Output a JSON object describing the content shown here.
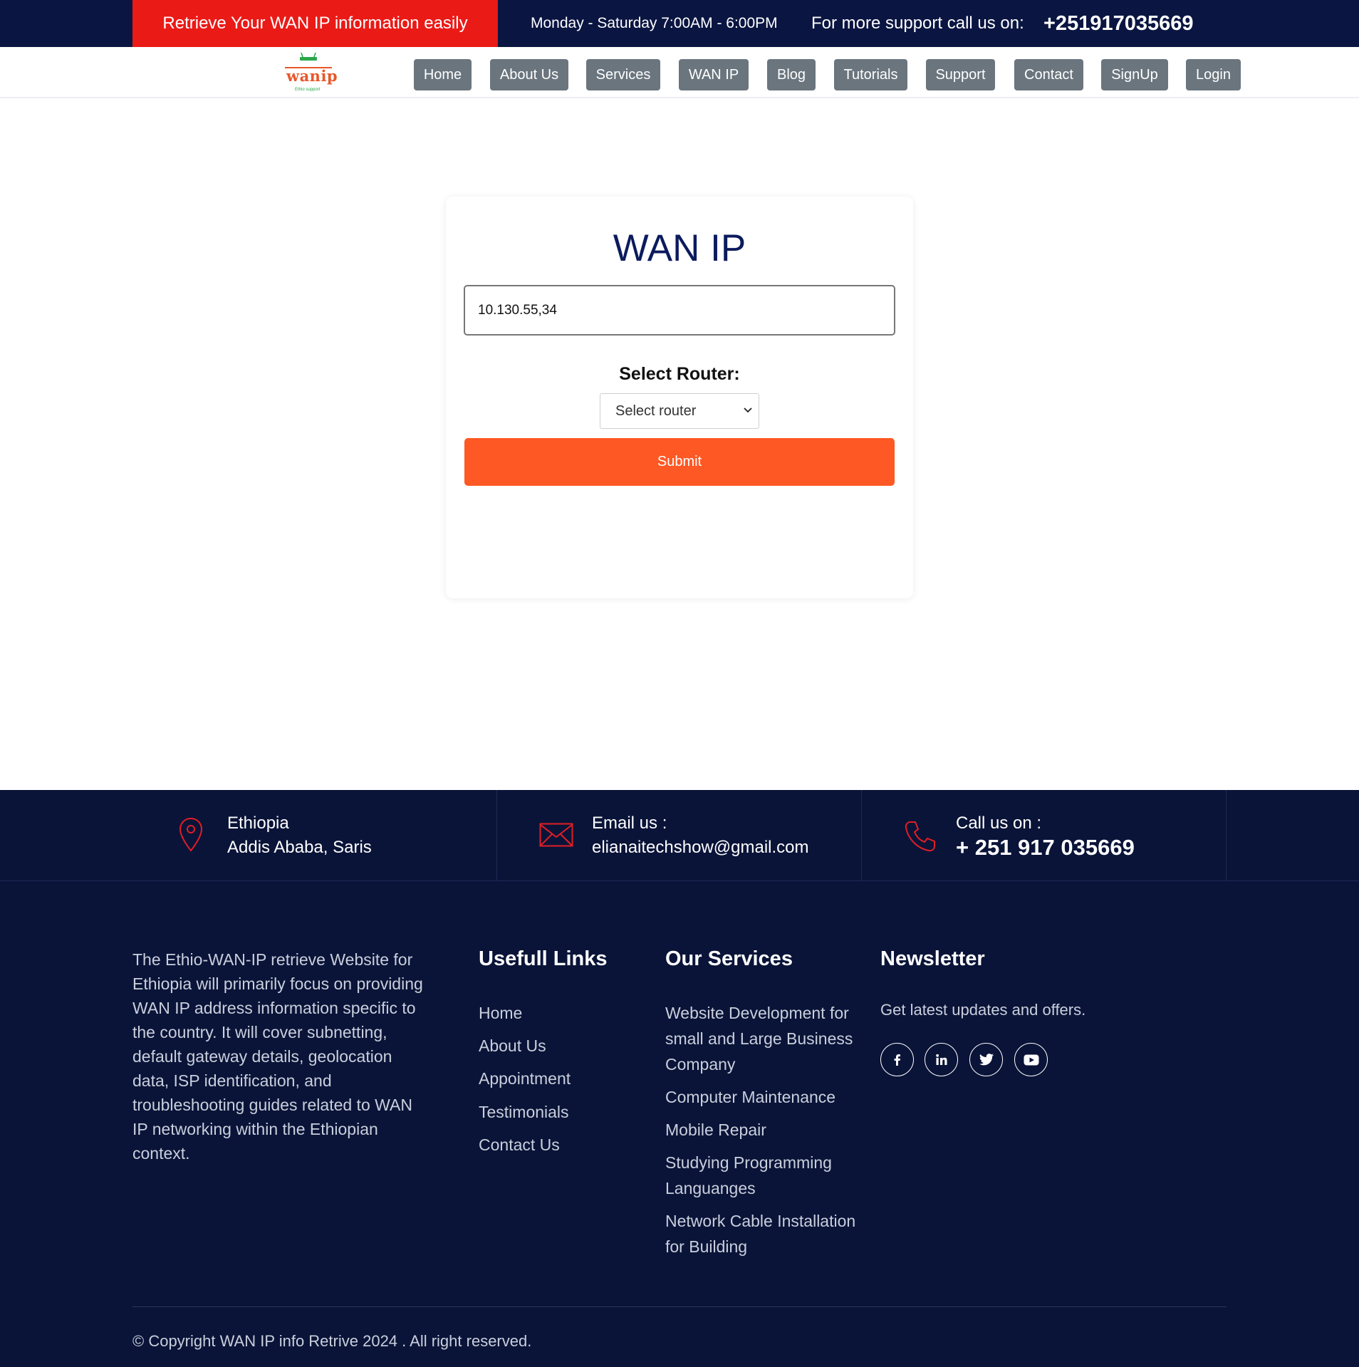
{
  "topbar": {
    "promo": "Retrieve Your WAN IP information easily",
    "hours": "Monday - Saturday 7:00AM - 6:00PM",
    "support_text": "For more support call us on:",
    "phone": "+251917035669"
  },
  "logo": {
    "text": "wanip",
    "tagline": "Ethio support"
  },
  "nav": [
    "Home",
    "About Us",
    "Services",
    "WAN IP",
    "Blog",
    "Tutorials",
    "Support",
    "Contact",
    "SignUp",
    "Login"
  ],
  "card": {
    "title": "WAN IP",
    "ip_value": "10.130.55,34",
    "router_label": "Select Router:",
    "router_selected": "Select router",
    "submit_label": "Submit"
  },
  "contact": {
    "location_line1": "Ethiopia",
    "location_line2": "Addis Ababa, Saris",
    "email_label": "Email us :",
    "email": "elianaitechshow@gmail.com",
    "call_label": "Call us on :",
    "call_number": "+ 251 917 035669"
  },
  "footer": {
    "about": "The Ethio-WAN-IP retrieve Website for Ethiopia will primarily focus on providing WAN IP address information specific to the country. It will cover subnetting, default gateway details, geolocation data, ISP identification, and troubleshooting guides related to WAN IP networking within the Ethiopian context.",
    "links_title": "Usefull Links",
    "links": [
      "Home",
      "About Us",
      "Appointment",
      "Testimonials",
      "Contact Us"
    ],
    "services_title": "Our Services",
    "services": [
      "Website Development for small and Large Business Company",
      "Computer Maintenance",
      "Mobile Repair",
      "Studying Programming Languanges",
      "Network Cable Installation for Building"
    ],
    "newsletter_title": "Newsletter",
    "newsletter_text": "Get latest updates and offers.",
    "social_icons": [
      "facebook-icon",
      "linkedin-icon",
      "twitter-icon",
      "youtube-icon"
    ],
    "copyright": "© Copyright WAN IP info Retrive 2024 . All right reserved."
  },
  "colors": {
    "navy": "#0a1541",
    "footer_bg": "#0a1438",
    "promo_red": "#ea1a17",
    "nav_button": "#6a757e",
    "submit_orange": "#fe5824",
    "title_blue": "#0b1b5d",
    "icon_red": "#e01e26"
  }
}
